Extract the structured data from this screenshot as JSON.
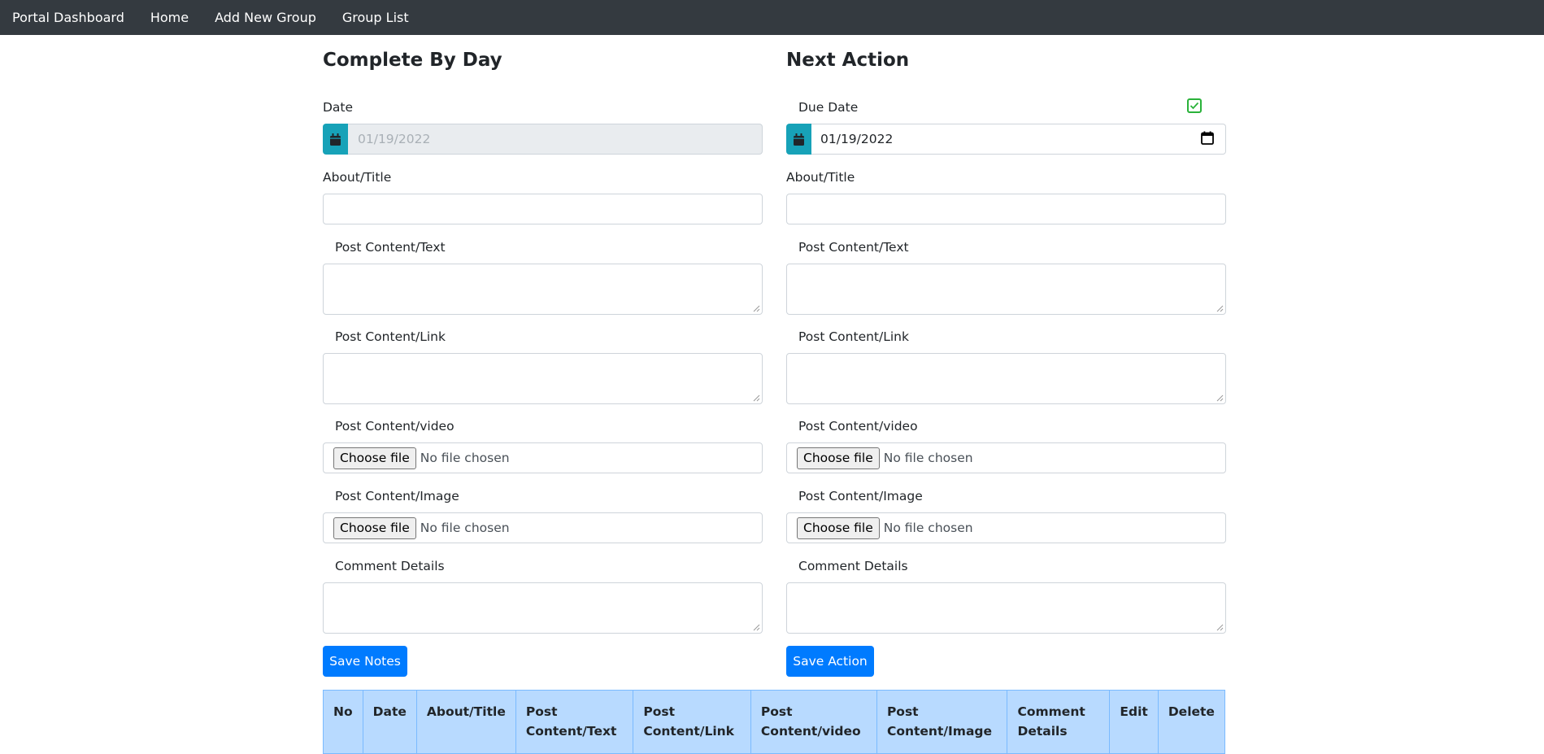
{
  "nav": {
    "brand": "Portal Dashboard",
    "items": [
      "Home",
      "Add New Group",
      "Group List"
    ]
  },
  "left": {
    "title": "Complete By Day",
    "date_label": "Date",
    "date_value": "01/19/2022",
    "about_label": "About/Title",
    "text_label": "Post Content/Text",
    "link_label": "Post Content/Link",
    "video_label": "Post Content/video",
    "image_label": "Post Content/Image",
    "comment_label": "Comment Details",
    "choose_file": "Choose file",
    "no_file": "No file chosen",
    "save_button": "Save Notes"
  },
  "right": {
    "title": "Next Action",
    "due_label": "Due Date",
    "due_value": "01/19/2022",
    "due_checked": true,
    "about_label": "About/Title",
    "text_label": "Post Content/Text",
    "link_label": "Post Content/Link",
    "video_label": "Post Content/video",
    "image_label": "Post Content/Image",
    "comment_label": "Comment Details",
    "choose_file": "Choose file",
    "no_file": "No file chosen",
    "save_button": "Save Action"
  },
  "table": {
    "headers": [
      "No",
      "Date",
      "About/Title",
      "Post Content/Text",
      "Post Content/Link",
      "Post Content/video",
      "Post Content/Image",
      "Comment Details",
      "Edit",
      "Delete"
    ]
  },
  "colors": {
    "navbar": "#343a40",
    "addon": "#17a2b8",
    "primary": "#007bff",
    "table_header": "#b8daff",
    "checkbox": "#2ab23a"
  },
  "icons": {
    "date_addon": "calendar-icon",
    "picker": "calendar-picker-icon",
    "check": "checkbox-icon"
  }
}
